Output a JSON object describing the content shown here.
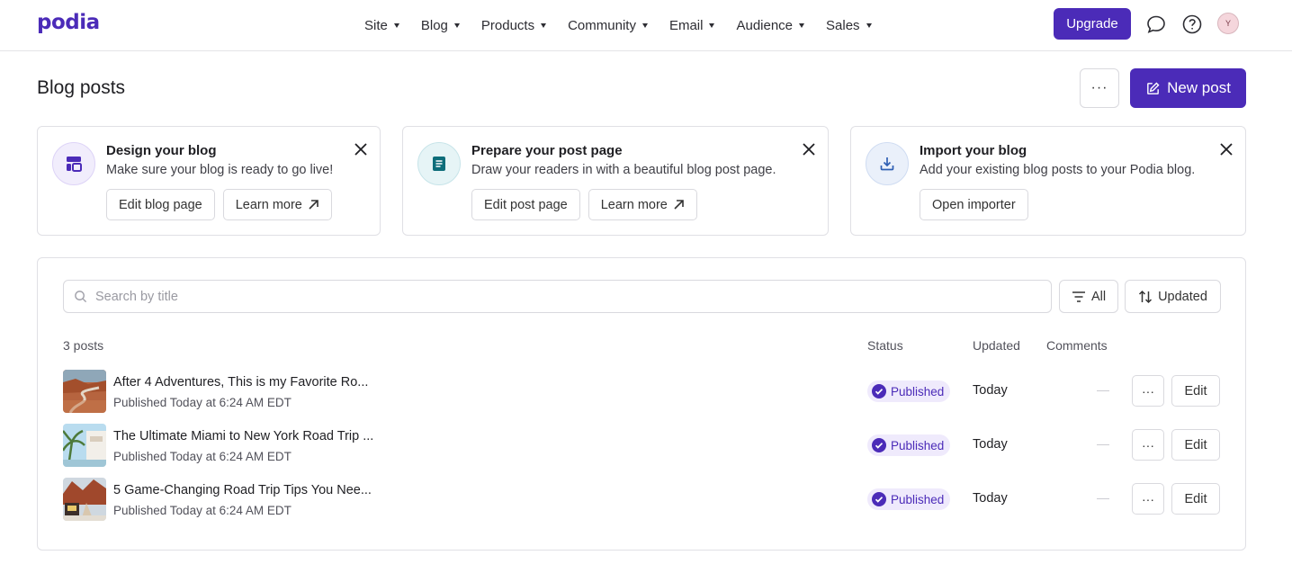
{
  "app": {
    "logo": "podia"
  },
  "nav": {
    "items": [
      {
        "label": "Site"
      },
      {
        "label": "Blog"
      },
      {
        "label": "Products"
      },
      {
        "label": "Community"
      },
      {
        "label": "Email"
      },
      {
        "label": "Audience"
      },
      {
        "label": "Sales"
      }
    ],
    "upgrade_label": "Upgrade",
    "avatar_initial": "Y"
  },
  "header": {
    "title": "Blog posts",
    "more_label": "···",
    "new_post_label": "New post"
  },
  "cards": [
    {
      "title": "Design your blog",
      "description": "Make sure your blog is ready to go live!",
      "buttons": [
        "Edit blog page",
        "Learn more"
      ],
      "icon": "layout-icon",
      "icon_color": "#4b2bb8",
      "icon_bg": "#f1edfc"
    },
    {
      "title": "Prepare your post page",
      "description": "Draw your readers in with a beautiful blog post page.",
      "buttons": [
        "Edit post page",
        "Learn more"
      ],
      "icon": "document-icon",
      "icon_color": "#0e6d7a",
      "icon_bg": "#e6f4f6"
    },
    {
      "title": "Import your blog",
      "description": "Add your existing blog posts to your Podia blog.",
      "buttons": [
        "Open importer"
      ],
      "icon": "import-icon",
      "icon_color": "#2f5fb3",
      "icon_bg": "#eaf0fa"
    }
  ],
  "posts_panel": {
    "search_placeholder": "Search by title",
    "filter_label": "All",
    "sort_label": "Updated",
    "count_label": "3 posts",
    "columns": {
      "status": "Status",
      "updated": "Updated",
      "comments": "Comments"
    },
    "rows": [
      {
        "title": "After 4 Adventures, This is my Favorite Ro...",
        "meta": "Published Today at 6:24 AM EDT",
        "status": "Published",
        "updated": "Today",
        "comments": "—",
        "edit_label": "Edit",
        "more_label": "···"
      },
      {
        "title": "The Ultimate Miami to New York Road Trip ...",
        "meta": "Published Today at 6:24 AM EDT",
        "status": "Published",
        "updated": "Today",
        "comments": "—",
        "edit_label": "Edit",
        "more_label": "···"
      },
      {
        "title": "5 Game-Changing Road Trip Tips You Nee...",
        "meta": "Published Today at 6:24 AM EDT",
        "status": "Published",
        "updated": "Today",
        "comments": "—",
        "edit_label": "Edit",
        "more_label": "···"
      }
    ]
  },
  "colors": {
    "brand": "#4b2bb8",
    "badge_bg": "#efeafc"
  }
}
